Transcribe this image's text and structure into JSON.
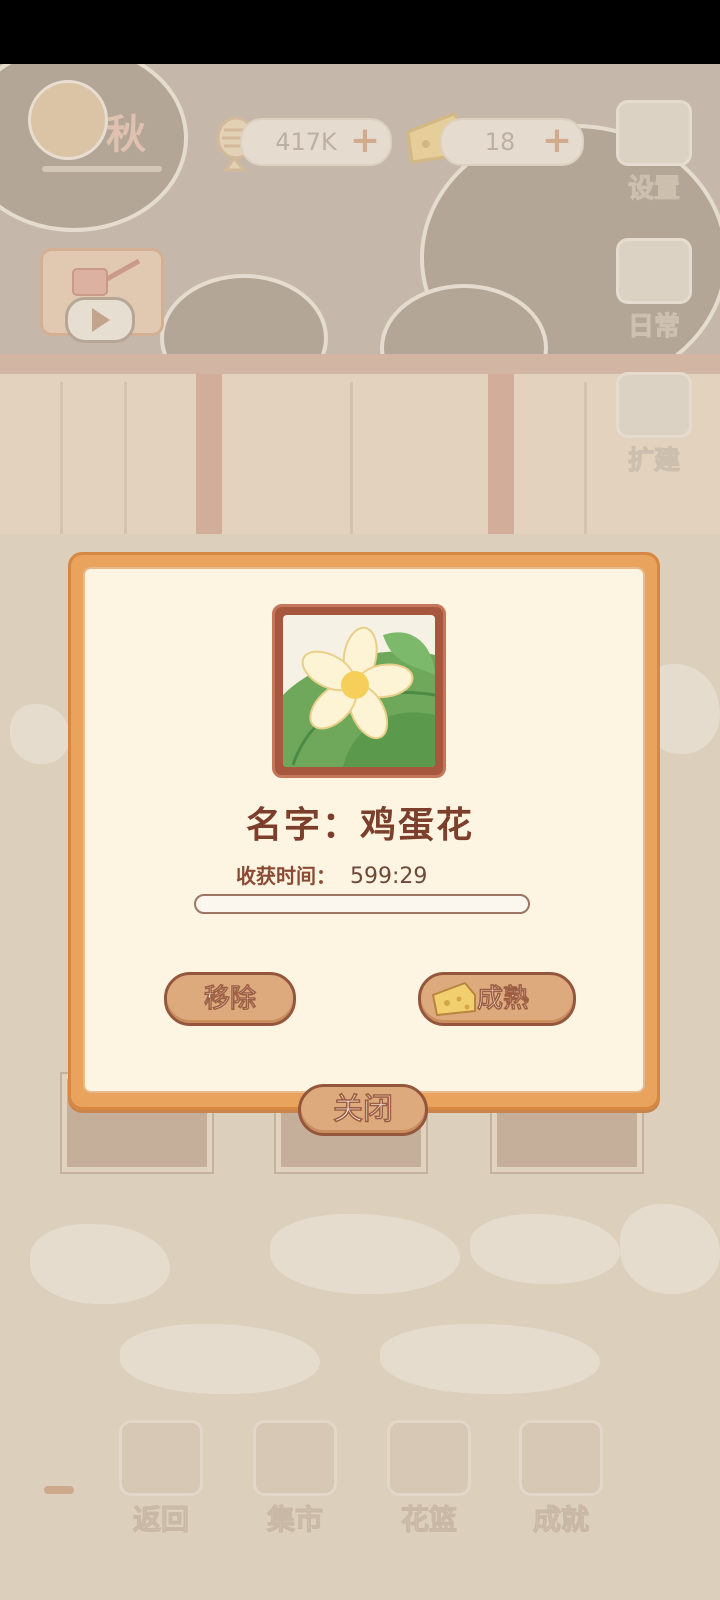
{
  "hud": {
    "season": "秋",
    "fish_currency": "417K",
    "cheese_currency": "18",
    "plus_symbol": "+",
    "settings_label": "设置",
    "daily_label": "日常",
    "expand_label": "扩建"
  },
  "bottom_nav": {
    "back_label": "返回",
    "market_label": "集市",
    "basket_label": "花篮",
    "achievement_label": "成就"
  },
  "dialog": {
    "name_text": "名字：鸡蛋花",
    "harvest_label": "收获时间：",
    "harvest_time": "599:29",
    "progress": 0.0,
    "remove_label": "移除",
    "ripen_label": "成熟",
    "close_label": "关闭"
  },
  "colors": {
    "dialog_border": "#e9a35c",
    "dialog_bg": "#fdf5e1",
    "button_bg": "#ddaa7e",
    "button_border": "#94563c",
    "name_text": "#7c3f2c"
  }
}
